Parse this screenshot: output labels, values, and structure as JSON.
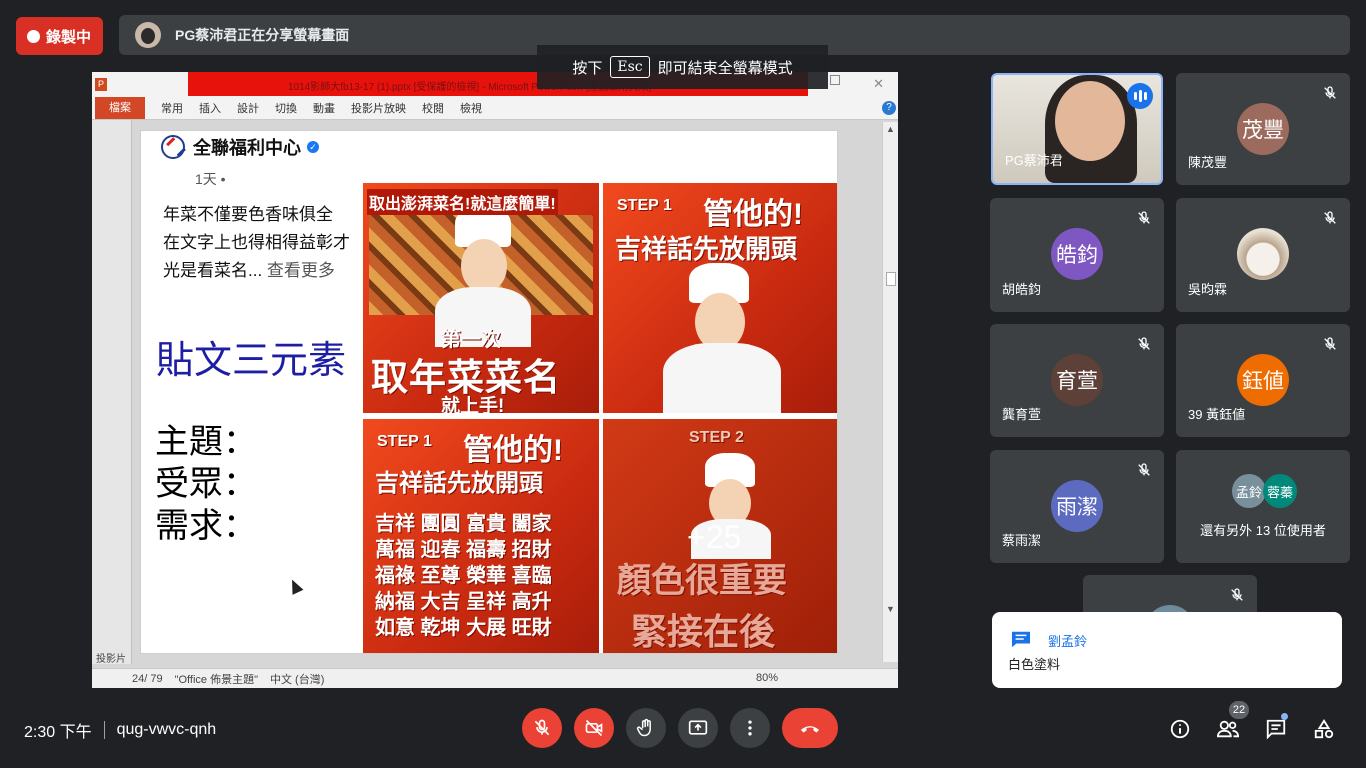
{
  "recording": {
    "label": "錄製中"
  },
  "share_banner": {
    "text": "PG蔡沛君正在分享螢幕畫面"
  },
  "esc_hint": {
    "prefix": "按下",
    "key": "Esc",
    "suffix": "即可結束全螢幕模式"
  },
  "ppt": {
    "title": "1014影師大fb13-17 (1).pptx [受保護的檢視] - Microsoft PowerPoint (產品啟用失敗)",
    "file_tab": "檔案",
    "tabs": [
      "常用",
      "插入",
      "設計",
      "切換",
      "動畫",
      "投影片放映",
      "校閱",
      "檢視"
    ],
    "left_label": "投影片",
    "status": {
      "slide": "24/ 79",
      "theme": "\"Office 佈景主題\"",
      "lang": "中文 (台灣)",
      "zoom": "80%"
    }
  },
  "slide": {
    "page_name": "全聯福利中心",
    "time": "1天 •",
    "post_lines": [
      "年菜不僅要色香味俱全",
      "在文字上也得相得益彰才",
      "光是看菜名..."
    ],
    "see_more": "查看更多",
    "big_title": "貼文三元素",
    "elements": [
      "主題：",
      "受眾：",
      "需求："
    ],
    "tile1": {
      "header": "取出澎湃菜名!就這麼簡單!",
      "line1": "第一次",
      "line2": "取年菜菜名",
      "line3": "就上手!"
    },
    "tile2": {
      "step": "STEP 1",
      "title": "管他的!",
      "subtitle": "吉祥話先放開頭"
    },
    "tile3": {
      "step": "STEP 1",
      "title": "管他的!",
      "subtitle": "吉祥話先放開頭",
      "words": [
        "吉祥 團圓 富貴 闔家",
        "萬福 迎春 福壽 招財",
        "福祿 至尊 榮華 喜臨",
        "納福 大吉 呈祥 高升",
        "如意 乾坤 大展 旺財"
      ]
    },
    "tile4": {
      "step": "STEP 2",
      "overlay": "+25",
      "line1": "顏色很重要",
      "line2": "緊接在後"
    }
  },
  "participants": [
    {
      "name": "PG蔡沛君",
      "type": "video",
      "speaking": true
    },
    {
      "name": "陳茂豐",
      "initials": "茂豐",
      "color": "#9c6b5e",
      "muted": true
    },
    {
      "name": "胡皓鈞",
      "initials": "皓鈞",
      "color": "#7e57c2",
      "muted": true
    },
    {
      "name": "吳昀霖",
      "type": "cat",
      "muted": true
    },
    {
      "name": "龔育萱",
      "initials": "育萱",
      "color": "#5d4037",
      "muted": true
    },
    {
      "name": "39 黃鈺値",
      "initials": "鈺値",
      "color": "#ef6c00",
      "muted": true
    },
    {
      "name": "蔡雨潔",
      "initials": "雨潔",
      "color": "#5c6bc0",
      "muted": true
    },
    {
      "name": "還有另外 13 位使用者",
      "initials_a": "孟鈴",
      "initials_b": "蓉蓁",
      "color_a": "#78909c",
      "color_b": "#00897b"
    }
  ],
  "toast": {
    "sender": "劉孟鈴",
    "message": "白色塗料"
  },
  "bottom": {
    "time": "2:30 下午",
    "meeting_code": "qug-vwvc-qnh",
    "people_count": "22"
  },
  "colors": {
    "record_red": "#d93025",
    "hangup_red": "#ea4335",
    "accent_blue": "#8ab4f8",
    "bg": "#202124",
    "tile": "#3c4043"
  }
}
